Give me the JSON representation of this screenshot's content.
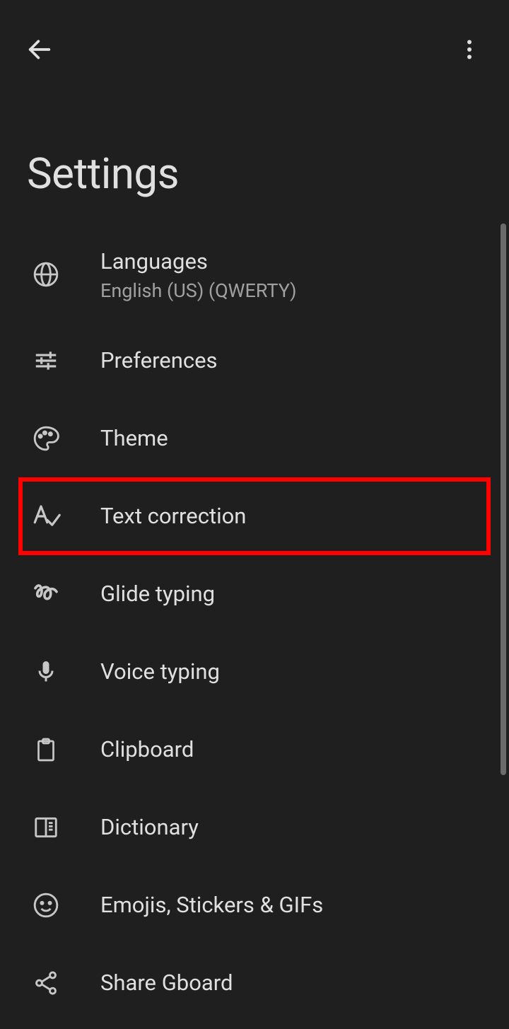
{
  "header": {
    "title": "Settings"
  },
  "items": [
    {
      "icon": "globe",
      "title": "Languages",
      "subtitle": "English (US) (QWERTY)",
      "highlighted": false
    },
    {
      "icon": "tune",
      "title": "Preferences",
      "subtitle": null,
      "highlighted": false
    },
    {
      "icon": "palette",
      "title": "Theme",
      "subtitle": null,
      "highlighted": false
    },
    {
      "icon": "text-correct",
      "title": "Text correction",
      "subtitle": null,
      "highlighted": true
    },
    {
      "icon": "gesture",
      "title": "Glide typing",
      "subtitle": null,
      "highlighted": false
    },
    {
      "icon": "mic",
      "title": "Voice typing",
      "subtitle": null,
      "highlighted": false
    },
    {
      "icon": "clipboard",
      "title": "Clipboard",
      "subtitle": null,
      "highlighted": false
    },
    {
      "icon": "book",
      "title": "Dictionary",
      "subtitle": null,
      "highlighted": false
    },
    {
      "icon": "emoji",
      "title": "Emojis, Stickers & GIFs",
      "subtitle": null,
      "highlighted": false
    },
    {
      "icon": "share",
      "title": "Share Gboard",
      "subtitle": null,
      "highlighted": false
    }
  ]
}
